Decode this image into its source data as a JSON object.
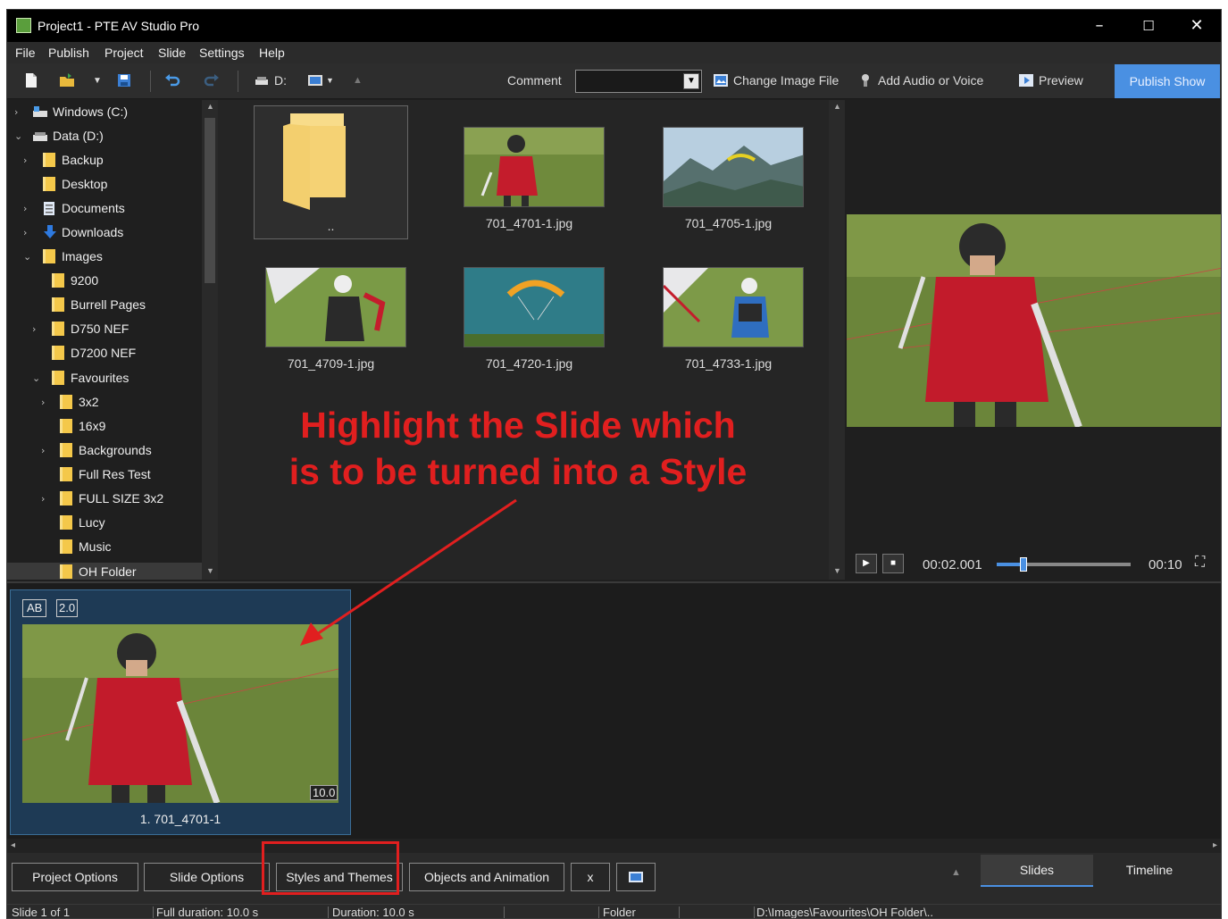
{
  "window": {
    "title": "Project1 - PTE AV Studio Pro",
    "minimize": "–",
    "maximize": "☐",
    "close": "✕"
  },
  "menu": [
    "File",
    "Publish",
    "Project",
    "Slide",
    "Settings",
    "Help"
  ],
  "toolbar": {
    "drive": "D:",
    "comment_label": "Comment",
    "comment_value": "",
    "change_image": "Change Image File",
    "add_audio": "Add Audio or Voice",
    "preview": "Preview",
    "publish": "Publish Show"
  },
  "tree": [
    {
      "label": "Windows (C:)",
      "icon": "drive-icon",
      "expanded": false
    },
    {
      "label": "Data (D:)",
      "icon": "drive-icon",
      "expanded": true
    },
    {
      "label": "Backup",
      "icon": "folder-icon",
      "expanded": false
    },
    {
      "label": "Desktop",
      "icon": "folder-icon"
    },
    {
      "label": "Documents",
      "icon": "documents-icon",
      "expanded": false
    },
    {
      "label": "Downloads",
      "icon": "downloads-icon",
      "expanded": false
    },
    {
      "label": "Images",
      "icon": "folder-icon",
      "expanded": true
    },
    {
      "label": "9200",
      "icon": "folder-icon"
    },
    {
      "label": "Burrell Pages",
      "icon": "folder-icon"
    },
    {
      "label": "D750 NEF",
      "icon": "folder-icon",
      "expanded": false
    },
    {
      "label": "D7200 NEF",
      "icon": "folder-icon"
    },
    {
      "label": "Favourites",
      "icon": "folder-icon",
      "expanded": true
    },
    {
      "label": "3x2",
      "icon": "folder-icon",
      "expanded": false
    },
    {
      "label": "16x9",
      "icon": "folder-icon"
    },
    {
      "label": "Backgrounds",
      "icon": "folder-icon",
      "expanded": false
    },
    {
      "label": "Full Res Test",
      "icon": "folder-icon"
    },
    {
      "label": "FULL SIZE 3x2",
      "icon": "folder-icon",
      "expanded": false
    },
    {
      "label": "Lucy",
      "icon": "folder-icon"
    },
    {
      "label": "Music",
      "icon": "folder-icon"
    },
    {
      "label": "OH Folder",
      "icon": "folder-icon"
    }
  ],
  "files": [
    {
      "name": "..",
      "kind": "folder"
    },
    {
      "name": "701_4701-1.jpg",
      "kind": "pilot-red"
    },
    {
      "name": "701_4705-1.jpg",
      "kind": "mountains"
    },
    {
      "name": "701_4709-1.jpg",
      "kind": "pilot-black"
    },
    {
      "name": "701_4720-1.jpg",
      "kind": "glider-lake"
    },
    {
      "name": "701_4733-1.jpg",
      "kind": "pilot-blue"
    }
  ],
  "player": {
    "time": "00:02.001",
    "total": "00:10",
    "progress": 0.2
  },
  "slide": {
    "badge_ab": "AB",
    "badge_tr": "2.0",
    "duration": "10.0",
    "label": "1. 701_4701-1"
  },
  "buttons": {
    "project_options": "Project Options",
    "slide_options": "Slide Options",
    "styles_themes": "Styles and Themes",
    "objects_animation": "Objects and Animation",
    "x": "x"
  },
  "tabs": {
    "slides": "Slides",
    "timeline": "Timeline"
  },
  "status": {
    "slide": "Slide 1 of 1",
    "full_duration": "Full duration: 10.0 s",
    "duration": "Duration: 10.0 s",
    "folder": "Folder",
    "path": "D:\\Images\\Favourites\\OH Folder\\.."
  },
  "annotation": {
    "line1": "Highlight the Slide which",
    "line2": "is to be turned into a Style"
  },
  "colors": {
    "accent": "#4a90e2",
    "annotation": "#e11f1f",
    "selected_slide": "#1e3a55"
  }
}
